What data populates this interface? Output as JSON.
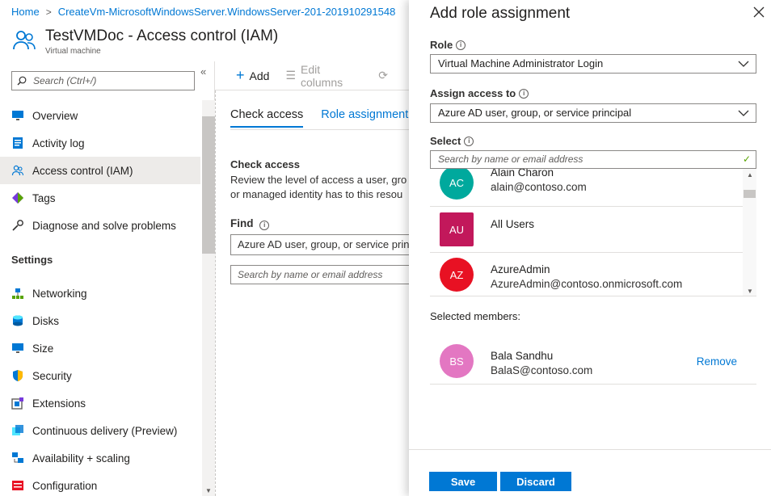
{
  "breadcrumb": {
    "home": "Home",
    "current": "CreateVm-MicrosoftWindowsServer.WindowsServer-201-201910291548"
  },
  "header": {
    "title": "TestVMDoc - Access control (IAM)",
    "subtitle": "Virtual machine"
  },
  "sidebar": {
    "search_placeholder": "Search (Ctrl+/)",
    "items": [
      {
        "label": "Overview",
        "icon": "monitor-icon"
      },
      {
        "label": "Activity log",
        "icon": "activity-log-icon"
      },
      {
        "label": "Access control (IAM)",
        "icon": "people-icon",
        "active": true
      },
      {
        "label": "Tags",
        "icon": "tag-icon"
      },
      {
        "label": "Diagnose and solve problems",
        "icon": "wrench-icon"
      }
    ],
    "section_settings": "Settings",
    "settings_items": [
      {
        "label": "Networking",
        "icon": "network-icon"
      },
      {
        "label": "Disks",
        "icon": "disk-icon"
      },
      {
        "label": "Size",
        "icon": "size-icon"
      },
      {
        "label": "Security",
        "icon": "shield-icon"
      },
      {
        "label": "Extensions",
        "icon": "extensions-icon"
      },
      {
        "label": "Continuous delivery (Preview)",
        "icon": "delivery-icon"
      },
      {
        "label": "Availability + scaling",
        "icon": "scaling-icon"
      },
      {
        "label": "Configuration",
        "icon": "configuration-icon"
      }
    ]
  },
  "toolbar": {
    "add_label": "Add",
    "edit_columns_label": "Edit columns"
  },
  "main": {
    "tabs": [
      "Check access",
      "Role assignment"
    ],
    "check_heading": "Check access",
    "check_desc_line1": "Review the level of access a user, gro",
    "check_desc_line2": "or managed identity has to this resou",
    "find_label": "Find",
    "find_value": "Azure AD user, group, or service prin",
    "find_search_placeholder": "Search by name or email address"
  },
  "panel": {
    "title": "Add role assignment",
    "role_label": "Role",
    "role_value": "Virtual Machine Administrator Login",
    "assign_label": "Assign access to",
    "assign_value": "Azure AD user, group, or service principal",
    "select_label": "Select",
    "select_placeholder": "Search by name or email address",
    "results": [
      {
        "initials": "AC",
        "name": "Alain Charon",
        "email": "alain@contoso.com",
        "color": "#00a99d"
      },
      {
        "initials": "AU",
        "name": "All Users",
        "email": "",
        "color": "#c2185b"
      },
      {
        "initials": "AZ",
        "name": "AzureAdmin",
        "email": "AzureAdmin@contoso.onmicrosoft.com",
        "color": "#e81123"
      }
    ],
    "selected_label": "Selected members:",
    "selected": {
      "initials": "BS",
      "name": "Bala Sandhu",
      "email": "BalaS@contoso.com",
      "color": "#e377c2"
    },
    "remove_label": "Remove",
    "save_label": "Save",
    "discard_label": "Discard"
  }
}
